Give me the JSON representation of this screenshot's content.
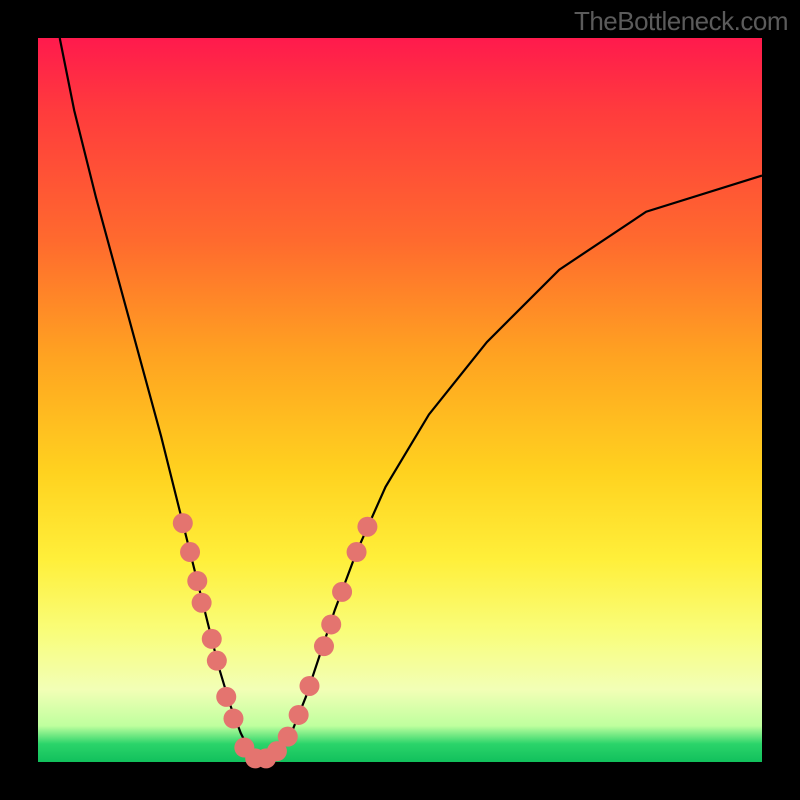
{
  "watermark": "TheBottleneck.com",
  "chart_data": {
    "type": "line",
    "title": "",
    "xlabel": "",
    "ylabel": "",
    "xlim": [
      0,
      100
    ],
    "ylim": [
      0,
      100
    ],
    "series": [
      {
        "name": "bottleneck-curve",
        "x": [
          3,
          5,
          8,
          11,
          14,
          17,
          19,
          21,
          23,
          25,
          26.5,
          28,
          29.5,
          31,
          33,
          35,
          37,
          39,
          41,
          44,
          48,
          54,
          62,
          72,
          84,
          100
        ],
        "y": [
          100,
          90,
          78,
          67,
          56,
          45,
          37,
          29,
          21,
          13,
          8,
          4,
          1,
          0,
          1,
          4,
          9,
          15,
          21,
          29,
          38,
          48,
          58,
          68,
          76,
          81
        ],
        "stroke": "#000000",
        "stroke_width": 2.2
      }
    ],
    "markers": {
      "name": "sample-points",
      "color": "#e4746f",
      "radius": 10,
      "points": [
        {
          "x": 20.0,
          "y": 33.0
        },
        {
          "x": 21.0,
          "y": 29.0
        },
        {
          "x": 22.0,
          "y": 25.0
        },
        {
          "x": 22.6,
          "y": 22.0
        },
        {
          "x": 24.0,
          "y": 17.0
        },
        {
          "x": 24.7,
          "y": 14.0
        },
        {
          "x": 26.0,
          "y": 9.0
        },
        {
          "x": 27.0,
          "y": 6.0
        },
        {
          "x": 28.5,
          "y": 2.0
        },
        {
          "x": 30.0,
          "y": 0.5
        },
        {
          "x": 31.5,
          "y": 0.5
        },
        {
          "x": 33.0,
          "y": 1.5
        },
        {
          "x": 34.5,
          "y": 3.5
        },
        {
          "x": 36.0,
          "y": 6.5
        },
        {
          "x": 37.5,
          "y": 10.5
        },
        {
          "x": 39.5,
          "y": 16.0
        },
        {
          "x": 40.5,
          "y": 19.0
        },
        {
          "x": 42.0,
          "y": 23.5
        },
        {
          "x": 44.0,
          "y": 29.0
        },
        {
          "x": 45.5,
          "y": 32.5
        }
      ]
    }
  }
}
